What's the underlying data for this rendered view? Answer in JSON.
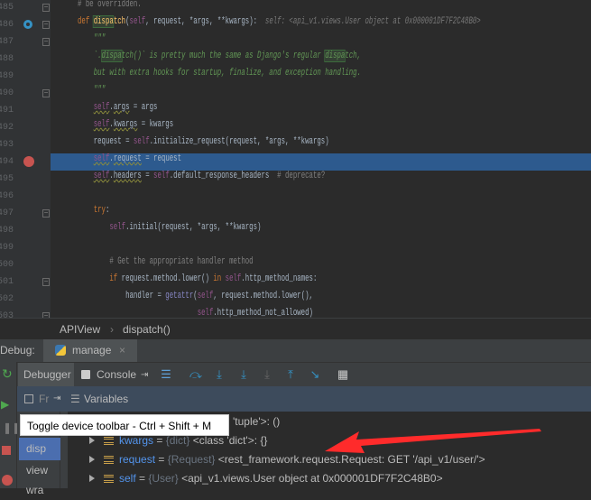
{
  "editor": {
    "lines": [
      {
        "n": "485"
      },
      {
        "n": "486"
      },
      {
        "n": "487"
      },
      {
        "n": "488"
      },
      {
        "n": "489"
      },
      {
        "n": "490"
      },
      {
        "n": "491"
      },
      {
        "n": "492"
      },
      {
        "n": "493"
      },
      {
        "n": "494"
      },
      {
        "n": "495"
      },
      {
        "n": "496"
      },
      {
        "n": "497"
      },
      {
        "n": "498"
      },
      {
        "n": "499"
      },
      {
        "n": "500"
      },
      {
        "n": "501"
      },
      {
        "n": "502"
      },
      {
        "n": "503"
      }
    ],
    "current_line": "494",
    "inline_hint": "self: <api_v1.views.User object at 0x000001DF7F2C48B0>"
  },
  "breadcrumb": {
    "items": [
      "APIView",
      "dispatch()"
    ]
  },
  "debug": {
    "label": "Debug:",
    "tab": "manage",
    "tabs": {
      "debugger": "Debugger",
      "console": "Console"
    },
    "frames_label": "Fr",
    "variables_label": "Variables",
    "frames": [
      "disp",
      "view",
      "wra"
    ]
  },
  "variables": [
    {
      "partial": "'tuple'>: ()"
    },
    {
      "name": "kwargs",
      "type": "{dict}",
      "value": "<class 'dict'>: {}"
    },
    {
      "name": "request",
      "type": "{Request}",
      "value": "<rest_framework.request.Request: GET '/api_v1/user/'>"
    },
    {
      "name": "self",
      "type": "{User}",
      "value": "<api_v1.views.User object at 0x000001DF7F2C48B0>"
    }
  ],
  "tooltip": "Toggle device toolbar - Ctrl + Shift + M",
  "colors": {
    "current_line": "#2d5a8e",
    "breakpoint": "#c75450",
    "annotation_arrow": "#ff2b2b"
  }
}
